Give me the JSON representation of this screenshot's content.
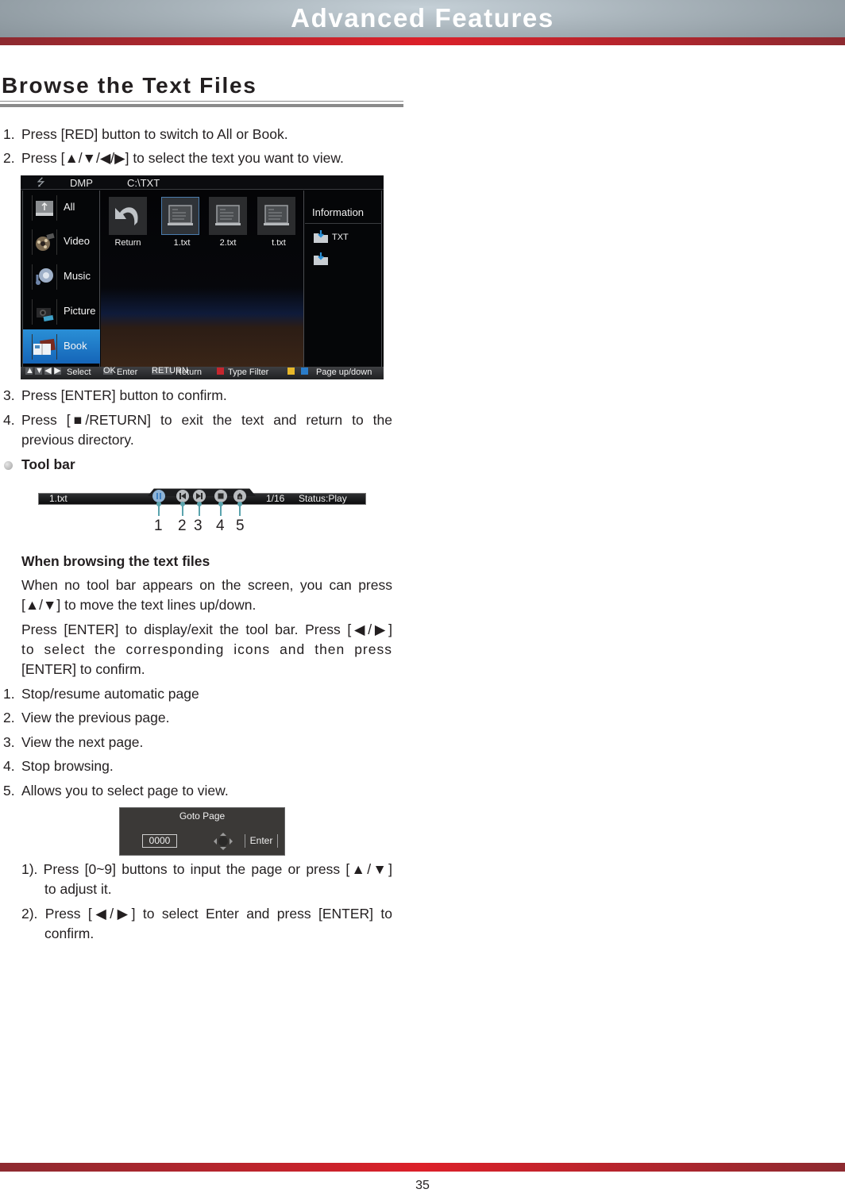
{
  "header": {
    "title": "Advanced Features",
    "accent_color": "#dc2029",
    "band_color": "#a9b4bb"
  },
  "section": {
    "title": "Browse the Text Files"
  },
  "steps_top": [
    {
      "num": "1.",
      "text": "Press [RED] button to switch to All or Book."
    },
    {
      "num": "2.",
      "text": "Press [▲/▼/◀/▶] to select the text you want to view."
    }
  ],
  "dmp_screen": {
    "title": "DMP",
    "path": "C:\\TXT",
    "sidebar": [
      {
        "label": "All",
        "icon": "usb-drive-icon",
        "active": false
      },
      {
        "label": "Video",
        "icon": "film-reel-icon",
        "active": false
      },
      {
        "label": "Music",
        "icon": "headphones-icon",
        "active": false
      },
      {
        "label": "Picture",
        "icon": "camera-icon",
        "active": false
      },
      {
        "label": "Book",
        "icon": "book-icon",
        "active": true
      }
    ],
    "files": [
      {
        "label": "Return",
        "icon": "return-arrow-icon",
        "selected": false
      },
      {
        "label": "1.txt",
        "icon": "text-file-icon",
        "selected": true
      },
      {
        "label": "2.txt",
        "icon": "text-file-icon",
        "selected": false
      },
      {
        "label": "t.txt",
        "icon": "text-file-icon",
        "selected": false
      }
    ],
    "info": {
      "title": "Information",
      "type": "TXT"
    },
    "hints": {
      "select": "Select",
      "ok_key": "OK",
      "enter": "Enter",
      "return_key": "RETURN",
      "return": "Return",
      "type_filter": "Type Filter",
      "page_updown": "Page up/down",
      "red": "#c4262e",
      "yellow": "#e8b82a",
      "blue": "#2a7cc9"
    }
  },
  "steps_mid": [
    {
      "num": "3.",
      "text": "Press [ENTER] button to confirm."
    },
    {
      "num": "4.",
      "text": "Press [■/RETURN] to exit the text and return to the",
      "text2": "previous directory."
    }
  ],
  "toolbar_section": {
    "heading": "Tool bar",
    "bar": {
      "filename": "1.txt",
      "page": "1/16",
      "status": "Status:Play"
    },
    "callouts": [
      "1",
      "2",
      "3",
      "4",
      "5"
    ],
    "callout_color": "#5aa3ad"
  },
  "browsing": {
    "heading": "When browsing the text files",
    "para1_line1": "When no tool bar appears on the screen, you can press",
    "para1_line2": "[▲/▼] to move the text lines up/down.",
    "para2_line1": "Press [ENTER] to display/exit the tool bar. Press [◀/▶]",
    "para2_line2": "to select the corresponding icons and then press",
    "para2_line3": "[ENTER] to confirm."
  },
  "toolbar_items": [
    {
      "num": "1.",
      "text": "Stop/resume automatic page"
    },
    {
      "num": "2.",
      "text": "View the previous page."
    },
    {
      "num": "3.",
      "text": "View the next page."
    },
    {
      "num": "4.",
      "text": "Stop browsing."
    },
    {
      "num": "5.",
      "text": "Allows you to select page to view."
    }
  ],
  "goto_dialog": {
    "title": "Goto Page",
    "value": "0000",
    "enter": "Enter"
  },
  "goto_steps": [
    {
      "line1": "1). Press [0~9] buttons to input the page or press [▲/▼]",
      "line2": "to adjust it."
    },
    {
      "line1": "2). Press [◀/▶] to select Enter and press [ENTER] to",
      "line2": "confirm."
    }
  ],
  "footer": {
    "page_number": "35"
  }
}
